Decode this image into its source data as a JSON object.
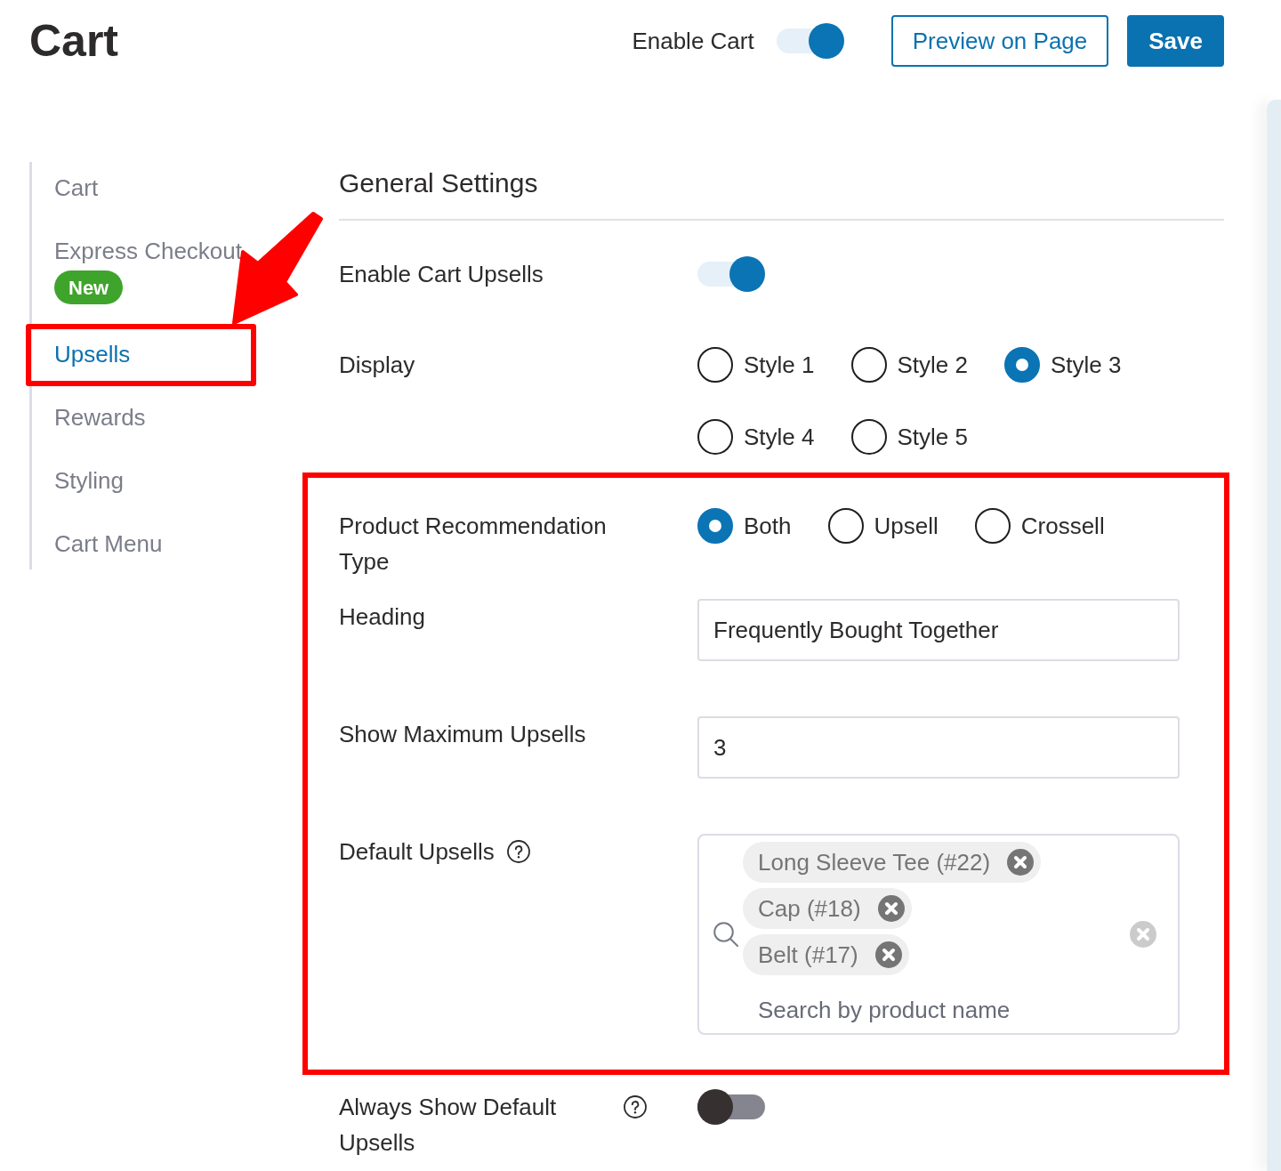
{
  "header": {
    "title": "Cart",
    "toggle": {
      "label": "Enable Cart",
      "on": true
    },
    "buttons": [
      {
        "label": "Preview on Page",
        "kind": "outline"
      },
      {
        "label": "Save",
        "kind": "primary"
      }
    ]
  },
  "sidebar": {
    "items": [
      {
        "label": "Cart",
        "selected": false,
        "highlighted": false
      },
      {
        "label": "Express Checkout",
        "badge": "New",
        "selected": false,
        "highlighted": false
      },
      {
        "label": "Upsells",
        "selected": true,
        "highlighted": true
      },
      {
        "label": "Rewards",
        "selected": false,
        "highlighted": false
      },
      {
        "label": "Styling",
        "selected": false,
        "highlighted": false
      },
      {
        "label": "Cart Menu",
        "selected": false,
        "highlighted": false
      }
    ]
  },
  "section": {
    "title": "General Settings",
    "settings": [
      {
        "kind": "toggle",
        "label": "Enable Cart Upsells",
        "on": true,
        "highlighted": false
      },
      {
        "kind": "radio",
        "label": "Display",
        "highlighted": false,
        "options": [
          {
            "label": "Style 1",
            "selected": false
          },
          {
            "label": "Style 2",
            "selected": false
          },
          {
            "label": "Style 3",
            "selected": true
          },
          {
            "label": "Style 4",
            "selected": false
          },
          {
            "label": "Style 5",
            "selected": false
          }
        ]
      },
      {
        "kind": "radio",
        "label": "Product Recommendation Type",
        "highlighted": true,
        "options": [
          {
            "label": "Both",
            "selected": true
          },
          {
            "label": "Upsell",
            "selected": false
          },
          {
            "label": "Crossell",
            "selected": false
          }
        ]
      },
      {
        "kind": "text",
        "label": "Heading",
        "value": "Frequently Bought Together",
        "highlighted": true
      },
      {
        "kind": "text",
        "label": "Show Maximum Upsells",
        "value": "3",
        "highlighted": true
      },
      {
        "kind": "multiselect",
        "label": "Default Upsells",
        "help": true,
        "highlighted": true,
        "tags": [
          "Long Sleeve Tee (#22)",
          "Cap (#18)",
          "Belt (#17)"
        ],
        "placeholder": "Search by product name"
      },
      {
        "kind": "toggle",
        "label": "Always Show Default Upsells",
        "help": true,
        "on": false,
        "highlighted": false
      }
    ]
  }
}
